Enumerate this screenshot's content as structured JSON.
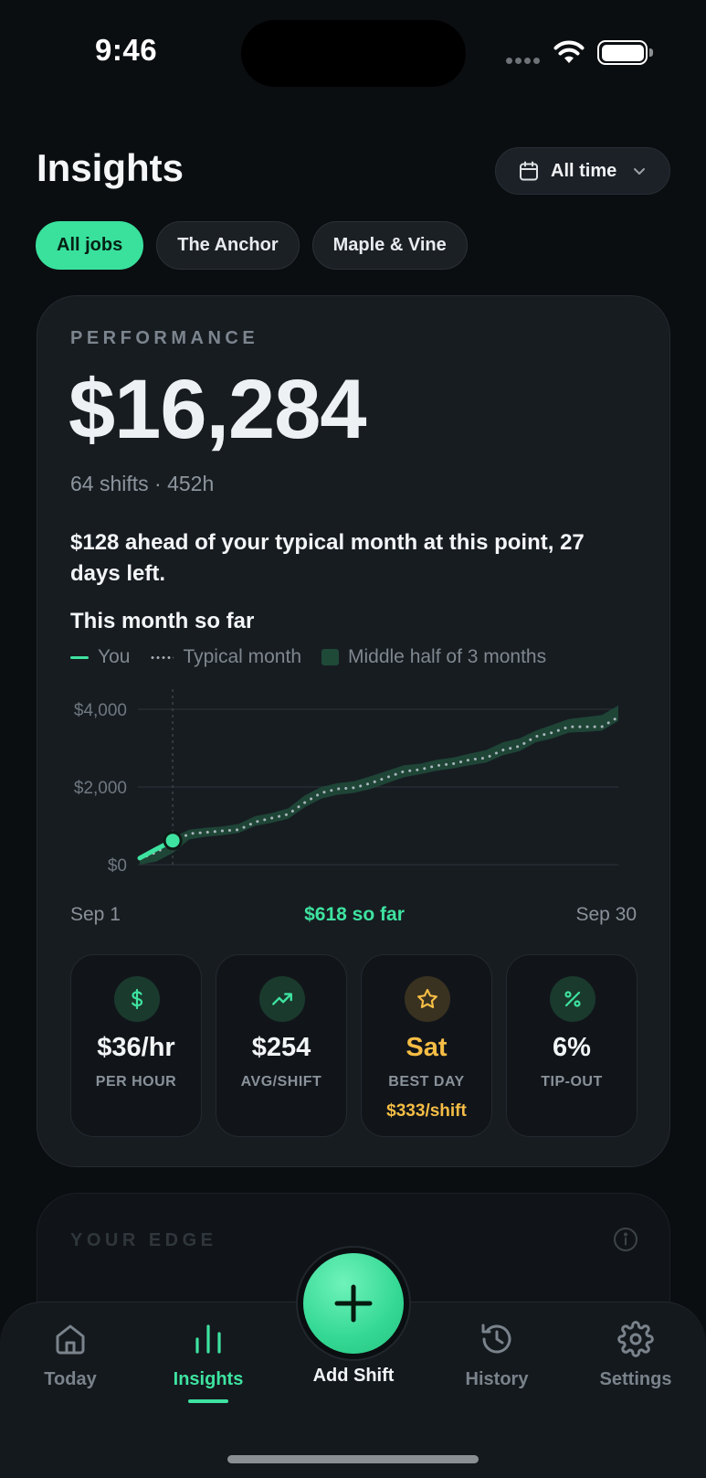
{
  "status_bar": {
    "time": "9:46"
  },
  "header": {
    "title": "Insights",
    "range_label": "All time"
  },
  "filters": [
    {
      "label": "All jobs",
      "active": true
    },
    {
      "label": "The Anchor",
      "active": false
    },
    {
      "label": "Maple & Vine",
      "active": false
    }
  ],
  "performance": {
    "label": "PERFORMANCE",
    "total": "$16,284",
    "subline": "64 shifts · 452h",
    "insight": "$128 ahead of your typical month at this point, 27 days left.",
    "chart_title": "This month so far",
    "legend": {
      "you": "You",
      "typical": "Typical month",
      "band": "Middle half of 3 months"
    },
    "x_start": "Sep 1",
    "x_mid": "$618 so far",
    "x_end": "Sep 30",
    "y_ticks": [
      "$4,000",
      "$2,000",
      "$0"
    ]
  },
  "chart_data": {
    "type": "line",
    "x": [
      1,
      2,
      3,
      4,
      5,
      6,
      7,
      8,
      9,
      10,
      11,
      12,
      13,
      14,
      15,
      16,
      17,
      18,
      19,
      20,
      21,
      22,
      23,
      24,
      25,
      26,
      27,
      28,
      29,
      30
    ],
    "ylim": [
      0,
      4000
    ],
    "series": [
      {
        "name": "You",
        "values": [
          170,
          400,
          618
        ]
      },
      {
        "name": "Typical month",
        "values": [
          150,
          320,
          560,
          800,
          830,
          870,
          900,
          1100,
          1200,
          1300,
          1600,
          1850,
          1950,
          1980,
          2100,
          2250,
          2400,
          2450,
          2550,
          2600,
          2700,
          2750,
          2950,
          3050,
          3300,
          3400,
          3550,
          3550,
          3550,
          3800
        ]
      },
      {
        "name": "Middle half of 3 months (low)",
        "values": [
          0,
          80,
          300,
          650,
          720,
          760,
          820,
          1000,
          1080,
          1180,
          1480,
          1700,
          1800,
          1850,
          1950,
          2100,
          2250,
          2330,
          2420,
          2480,
          2560,
          2630,
          2820,
          2920,
          3150,
          3250,
          3400,
          3420,
          3450,
          3700
        ]
      },
      {
        "name": "Middle half of 3 months (high)",
        "values": [
          200,
          380,
          700,
          900,
          950,
          980,
          1050,
          1250,
          1330,
          1450,
          1780,
          2000,
          2100,
          2150,
          2280,
          2420,
          2560,
          2600,
          2700,
          2760,
          2860,
          2950,
          3150,
          3250,
          3450,
          3600,
          3750,
          3800,
          3850,
          4100
        ]
      }
    ]
  },
  "stats": [
    {
      "icon": "dollar-icon",
      "value": "$36/hr",
      "caption": "PER HOUR"
    },
    {
      "icon": "trend-up-icon",
      "value": "$254",
      "caption": "AVG/SHIFT"
    },
    {
      "icon": "star-icon",
      "value": "Sat",
      "caption": "BEST DAY",
      "extra": "$333/shift"
    },
    {
      "icon": "percent-icon",
      "value": "6%",
      "caption": "TIP-OUT"
    }
  ],
  "edge": {
    "label": "YOUR EDGE"
  },
  "nav": {
    "today": "Today",
    "insights": "Insights",
    "add_shift": "Add Shift",
    "history": "History",
    "settings": "Settings"
  },
  "colors": {
    "accent": "#3ee3a0",
    "gold": "#f5bd45",
    "background": "#0b0e11",
    "card": "#171c21"
  }
}
